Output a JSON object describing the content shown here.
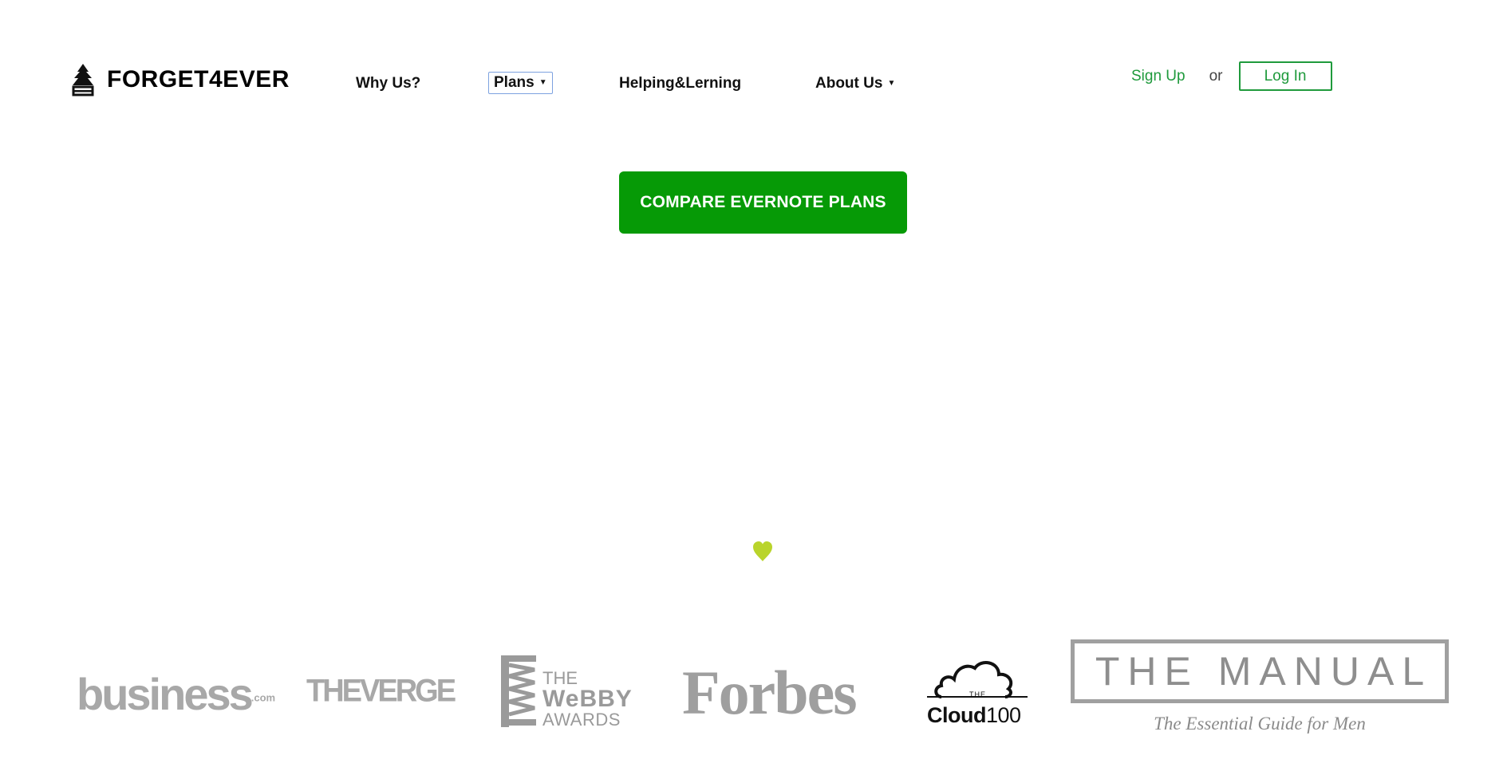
{
  "brand": {
    "name": "FORGET4EVER",
    "logo_icon": "tree-icon"
  },
  "nav": {
    "items": [
      {
        "label": "Why Us?",
        "dropdown": false
      },
      {
        "label": "Plans",
        "dropdown": true,
        "active": true
      },
      {
        "label": "Helping&Lerning",
        "dropdown": false
      },
      {
        "label": "About Us",
        "dropdown": true
      }
    ]
  },
  "auth": {
    "signup_label": "Sign Up",
    "or_label": "or",
    "login_label": "Log In"
  },
  "cta": {
    "label": "COMPARE EVERNOTE PLANS"
  },
  "heart": {
    "icon": "heart-icon",
    "color": "#b9d42b"
  },
  "press": {
    "business": {
      "name": "business",
      "suffix": ".com"
    },
    "verge": {
      "name": "THEVERGE"
    },
    "webby": {
      "line1": "THE",
      "line2": "WeBBY",
      "line3": "AWARDS"
    },
    "forbes": {
      "name": "Forbes"
    },
    "cloud100": {
      "the": "THE",
      "word": "Cloud",
      "number": "100"
    },
    "manual": {
      "title": "THE MANUAL",
      "subtitle": "The Essential Guide for Men"
    }
  },
  "colors": {
    "accent": "#1f9a3c",
    "cta": "#069a06"
  }
}
